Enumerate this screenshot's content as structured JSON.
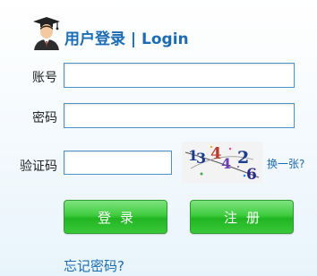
{
  "header": {
    "avatar_icon": "graduate-user-icon",
    "title": "用户登录 | Login",
    "title_color": "#1a6cb5"
  },
  "form": {
    "account_label": "账号",
    "account_value": "",
    "password_label": "密码",
    "password_value": "",
    "captcha_label": "验证码",
    "captcha_value": "",
    "captcha_text": "13442 6",
    "refresh_label": "换一张?"
  },
  "buttons": {
    "login_label": "登录",
    "register_label": "注册",
    "color": "#2fbf2f"
  },
  "links": {
    "forgot_password": "忘记密码?"
  }
}
